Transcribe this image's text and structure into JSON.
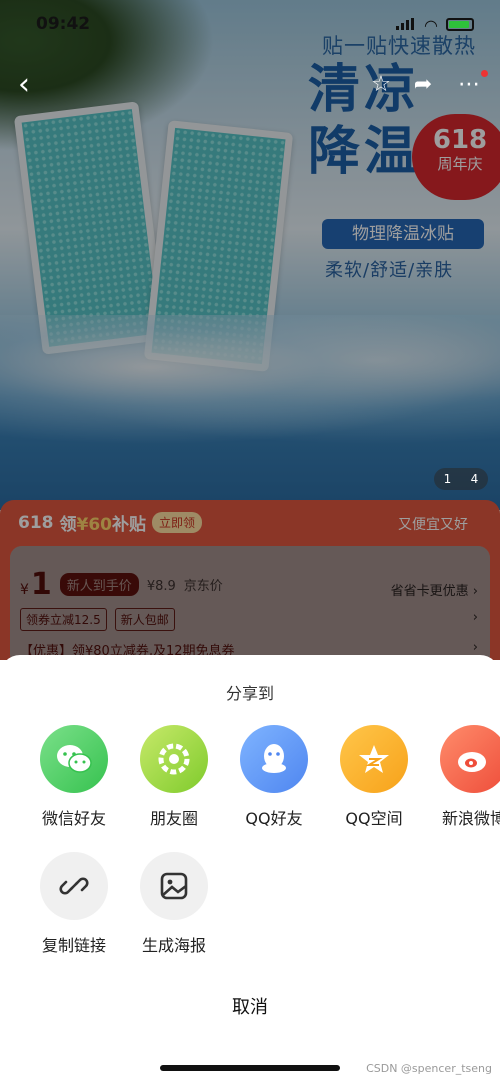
{
  "status_bar": {
    "time": "09:42"
  },
  "hero": {
    "ad_line1": "贴一贴快速散热",
    "ad_big1": "清凉",
    "ad_big2": "降温",
    "badge_number": "618",
    "badge_text": "周年庆",
    "pill": "物理降温冰贴",
    "tagline": "柔软/舒适/亲肤",
    "pager": {
      "current": "1",
      "total": "4"
    }
  },
  "promo": {
    "label_618": "618",
    "coupon": "领",
    "amount": "¥60",
    "subsidy": "补贴",
    "claim": "立即领",
    "right_text": "又便宜又好"
  },
  "price_card": {
    "yen": "¥",
    "price": "1",
    "new_user_pill": "新人到手价",
    "jd_price": "¥8.9",
    "jd_label": "京东价",
    "save_card": "省省卡更优惠",
    "tags": [
      "领券立减12.5",
      "新人包邮"
    ],
    "offer": "【优惠】领¥80立减券,及12期免息券"
  },
  "share_sheet": {
    "title": "分享到",
    "row1": [
      {
        "label": "微信好友",
        "icon": "wechat-icon"
      },
      {
        "label": "朋友圈",
        "icon": "moments-icon"
      },
      {
        "label": "QQ好友",
        "icon": "qq-icon"
      },
      {
        "label": "QQ空间",
        "icon": "qzone-icon"
      },
      {
        "label": "新浪微博",
        "icon": "weibo-icon"
      }
    ],
    "row2": [
      {
        "label": "复制链接",
        "icon": "link-icon"
      },
      {
        "label": "生成海报",
        "icon": "poster-icon"
      }
    ],
    "cancel": "取消"
  },
  "watermark": "CSDN @spencer_tseng",
  "colors": {
    "promo_red": "#e0583f",
    "wechat_green": "#36c24f",
    "qq_blue": "#4f86f0",
    "qzone_orange": "#f7a21a",
    "weibo_red": "#ee4d3a"
  }
}
